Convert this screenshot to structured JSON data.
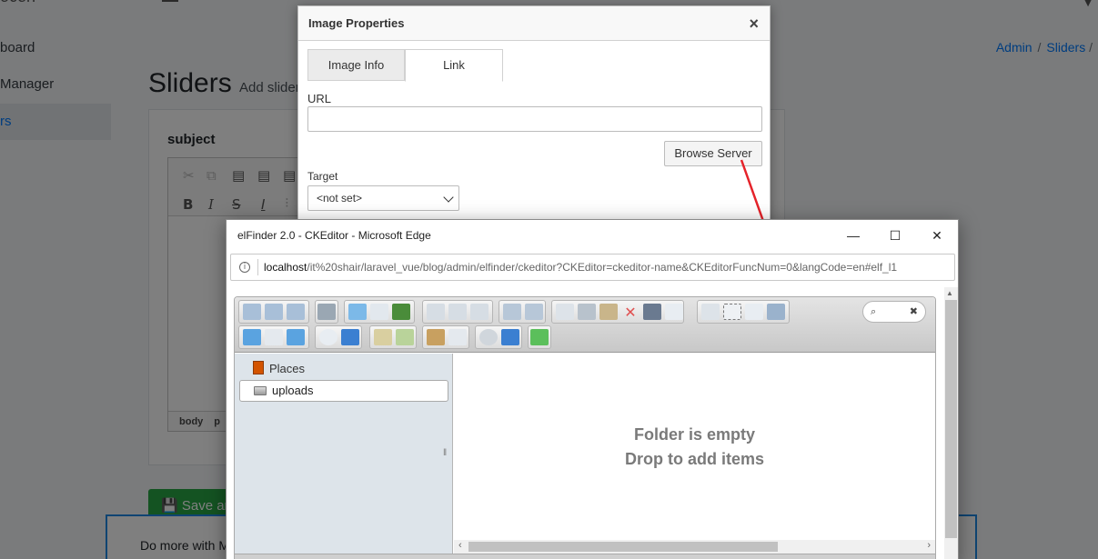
{
  "background": {
    "brand_fragment": "ocen",
    "sidebar": {
      "items": [
        {
          "label": "board"
        },
        {
          "label": "Manager"
        },
        {
          "label": "rs"
        }
      ]
    },
    "page_title": "Sliders",
    "page_subtitle": "Add slider",
    "breadcrumb": [
      "Admin",
      "Sliders",
      "/"
    ],
    "card": {
      "field_label": "subject",
      "editor_path": [
        "body",
        "p"
      ]
    },
    "save_button": "Save an",
    "toast_text": "Do more with M"
  },
  "dialog": {
    "title": "Image Properties",
    "close": "×",
    "tabs": [
      {
        "label": "Image Info",
        "active": false
      },
      {
        "label": "Link",
        "active": true
      }
    ],
    "url_label": "URL",
    "url_value": "",
    "browse_label": "Browse Server",
    "target_label": "Target",
    "target_value": "<not set>"
  },
  "edge_window": {
    "title": "elFinder 2.0 - CKEditor - Microsoft Edge",
    "minimize": "—",
    "maximize": "☐",
    "close": "✕",
    "address_host": "localhost",
    "address_rest": "/it%20shair/laravel_vue/blog/admin/elfinder/ckeditor?CKEditor=ckeditor-name&CKEditorFuncNum=0&langCode=en#elf_l1"
  },
  "elfinder": {
    "places_label": "Places",
    "root_label": "uploads",
    "empty_line1": "Folder is empty",
    "empty_line2": "Drop to add items",
    "search_icon": "⌕",
    "search_clear": "✖"
  },
  "colors": {
    "accent": "#007bff",
    "save": "#28a745",
    "arrow": "#e5232a"
  }
}
